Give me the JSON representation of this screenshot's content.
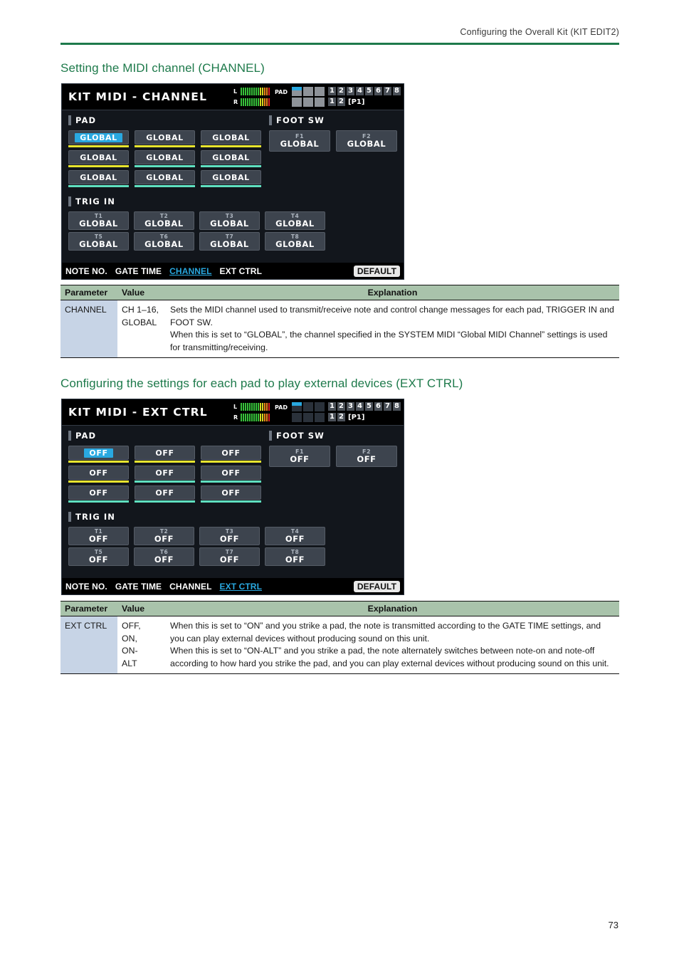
{
  "header": {
    "running_head": "Configuring the Overall Kit (KIT EDIT2)",
    "rule_color": "#1e7a4b"
  },
  "page_number": "73",
  "sections": [
    {
      "title": "Setting the MIDI channel (CHANNEL)",
      "screen": {
        "title": "KIT MIDI - CHANNEL",
        "hud": {
          "meter_left_label": "L",
          "meter_right_label": "R",
          "pad_label": "PAD",
          "channel_numbers_top": [
            "1",
            "2",
            "3",
            "4",
            "5",
            "6",
            "7",
            "8"
          ],
          "channel_numbers_bottom": [
            "1",
            "2"
          ],
          "page_indicator": "[P1]",
          "pad_cells_dark": false
        },
        "pad_group": {
          "label": "PAD",
          "buttons": [
            {
              "value": "GLOBAL",
              "underline": "yellow",
              "selected": true
            },
            {
              "value": "GLOBAL",
              "underline": "yellow",
              "selected": false
            },
            {
              "value": "GLOBAL",
              "underline": "yellow",
              "selected": false
            },
            {
              "value": "GLOBAL",
              "underline": "yellow",
              "selected": false
            },
            {
              "value": "GLOBAL",
              "underline": "teal",
              "selected": false
            },
            {
              "value": "GLOBAL",
              "underline": "teal",
              "selected": false
            },
            {
              "value": "GLOBAL",
              "underline": "teal",
              "selected": false
            },
            {
              "value": "GLOBAL",
              "underline": "teal",
              "selected": false
            },
            {
              "value": "GLOBAL",
              "underline": "teal",
              "selected": false
            }
          ]
        },
        "foot_sw_group": {
          "label": "FOOT SW",
          "buttons": [
            {
              "label": "F1",
              "value": "GLOBAL"
            },
            {
              "label": "F2",
              "value": "GLOBAL"
            }
          ]
        },
        "trig_in_group": {
          "label": "TRIG IN",
          "buttons": [
            {
              "label": "T1",
              "value": "GLOBAL"
            },
            {
              "label": "T2",
              "value": "GLOBAL"
            },
            {
              "label": "T3",
              "value": "GLOBAL"
            },
            {
              "label": "T4",
              "value": "GLOBAL"
            },
            {
              "label": "T5",
              "value": "GLOBAL"
            },
            {
              "label": "T6",
              "value": "GLOBAL"
            },
            {
              "label": "T7",
              "value": "GLOBAL"
            },
            {
              "label": "T8",
              "value": "GLOBAL"
            }
          ]
        },
        "footer": {
          "tabs": [
            {
              "label": "NOTE NO.",
              "active": false
            },
            {
              "label": "GATE TIME",
              "active": false
            },
            {
              "label": "CHANNEL",
              "active": true
            },
            {
              "label": "EXT CTRL",
              "active": false
            }
          ],
          "default_button": "DEFAULT"
        }
      },
      "table": {
        "columns": [
          "Parameter",
          "Value",
          "Explanation"
        ],
        "rows": [
          {
            "parameter": "CHANNEL",
            "value": "CH 1–16,\nGLOBAL",
            "explanation": "Sets the MIDI channel used to transmit/receive note and control change messages for each pad, TRIGGER IN and FOOT SW.\nWhen this is set to “GLOBAL”, the channel specified in the SYSTEM MIDI “Global MIDI Channel” settings is used for transmitting/receiving."
          }
        ]
      }
    },
    {
      "title": "Configuring the settings for each pad to play external devices (EXT CTRL)",
      "screen": {
        "title": "KIT MIDI - EXT CTRL",
        "hud": {
          "meter_left_label": "L",
          "meter_right_label": "R",
          "pad_label": "PAD",
          "channel_numbers_top": [
            "1",
            "2",
            "3",
            "4",
            "5",
            "6",
            "7",
            "8"
          ],
          "channel_numbers_bottom": [
            "1",
            "2"
          ],
          "page_indicator": "[P1]",
          "pad_cells_dark": true
        },
        "pad_group": {
          "label": "PAD",
          "buttons": [
            {
              "value": "OFF",
              "underline": "yellow",
              "selected": true
            },
            {
              "value": "OFF",
              "underline": "yellow",
              "selected": false
            },
            {
              "value": "OFF",
              "underline": "yellow",
              "selected": false
            },
            {
              "value": "OFF",
              "underline": "yellow",
              "selected": false
            },
            {
              "value": "OFF",
              "underline": "teal",
              "selected": false
            },
            {
              "value": "OFF",
              "underline": "teal",
              "selected": false
            },
            {
              "value": "OFF",
              "underline": "teal",
              "selected": false
            },
            {
              "value": "OFF",
              "underline": "teal",
              "selected": false
            },
            {
              "value": "OFF",
              "underline": "teal",
              "selected": false
            }
          ]
        },
        "foot_sw_group": {
          "label": "FOOT SW",
          "buttons": [
            {
              "label": "F1",
              "value": "OFF"
            },
            {
              "label": "F2",
              "value": "OFF"
            }
          ]
        },
        "trig_in_group": {
          "label": "TRIG IN",
          "buttons": [
            {
              "label": "T1",
              "value": "OFF"
            },
            {
              "label": "T2",
              "value": "OFF"
            },
            {
              "label": "T3",
              "value": "OFF"
            },
            {
              "label": "T4",
              "value": "OFF"
            },
            {
              "label": "T5",
              "value": "OFF"
            },
            {
              "label": "T6",
              "value": "OFF"
            },
            {
              "label": "T7",
              "value": "OFF"
            },
            {
              "label": "T8",
              "value": "OFF"
            }
          ]
        },
        "footer": {
          "tabs": [
            {
              "label": "NOTE NO.",
              "active": false
            },
            {
              "label": "GATE TIME",
              "active": false
            },
            {
              "label": "CHANNEL",
              "active": false
            },
            {
              "label": "EXT CTRL",
              "active": true
            }
          ],
          "default_button": "DEFAULT"
        }
      },
      "table": {
        "columns": [
          "Parameter",
          "Value",
          "Explanation"
        ],
        "rows": [
          {
            "parameter": "EXT CTRL",
            "value": "OFF,\nON,\nON-\nALT",
            "explanation": "When this is set to “ON” and you strike a pad, the note is transmitted according to the GATE TIME settings, and you can play external devices without producing sound on this unit.\nWhen this is set to “ON-ALT” and you strike a pad, the note alternately switches between note-on and note-off according to how hard you strike the pad, and you can play external devices without producing sound on this unit."
          }
        ]
      }
    }
  ],
  "colors": {
    "accent_green": "#1e7a4b",
    "lcd_highlight": "#29a8e0",
    "underline_yellow": "#e8e52e",
    "underline_teal": "#5fe0c0",
    "table_header_bg": "#a9c3ab",
    "table_param_bg": "#c7d4e6"
  }
}
